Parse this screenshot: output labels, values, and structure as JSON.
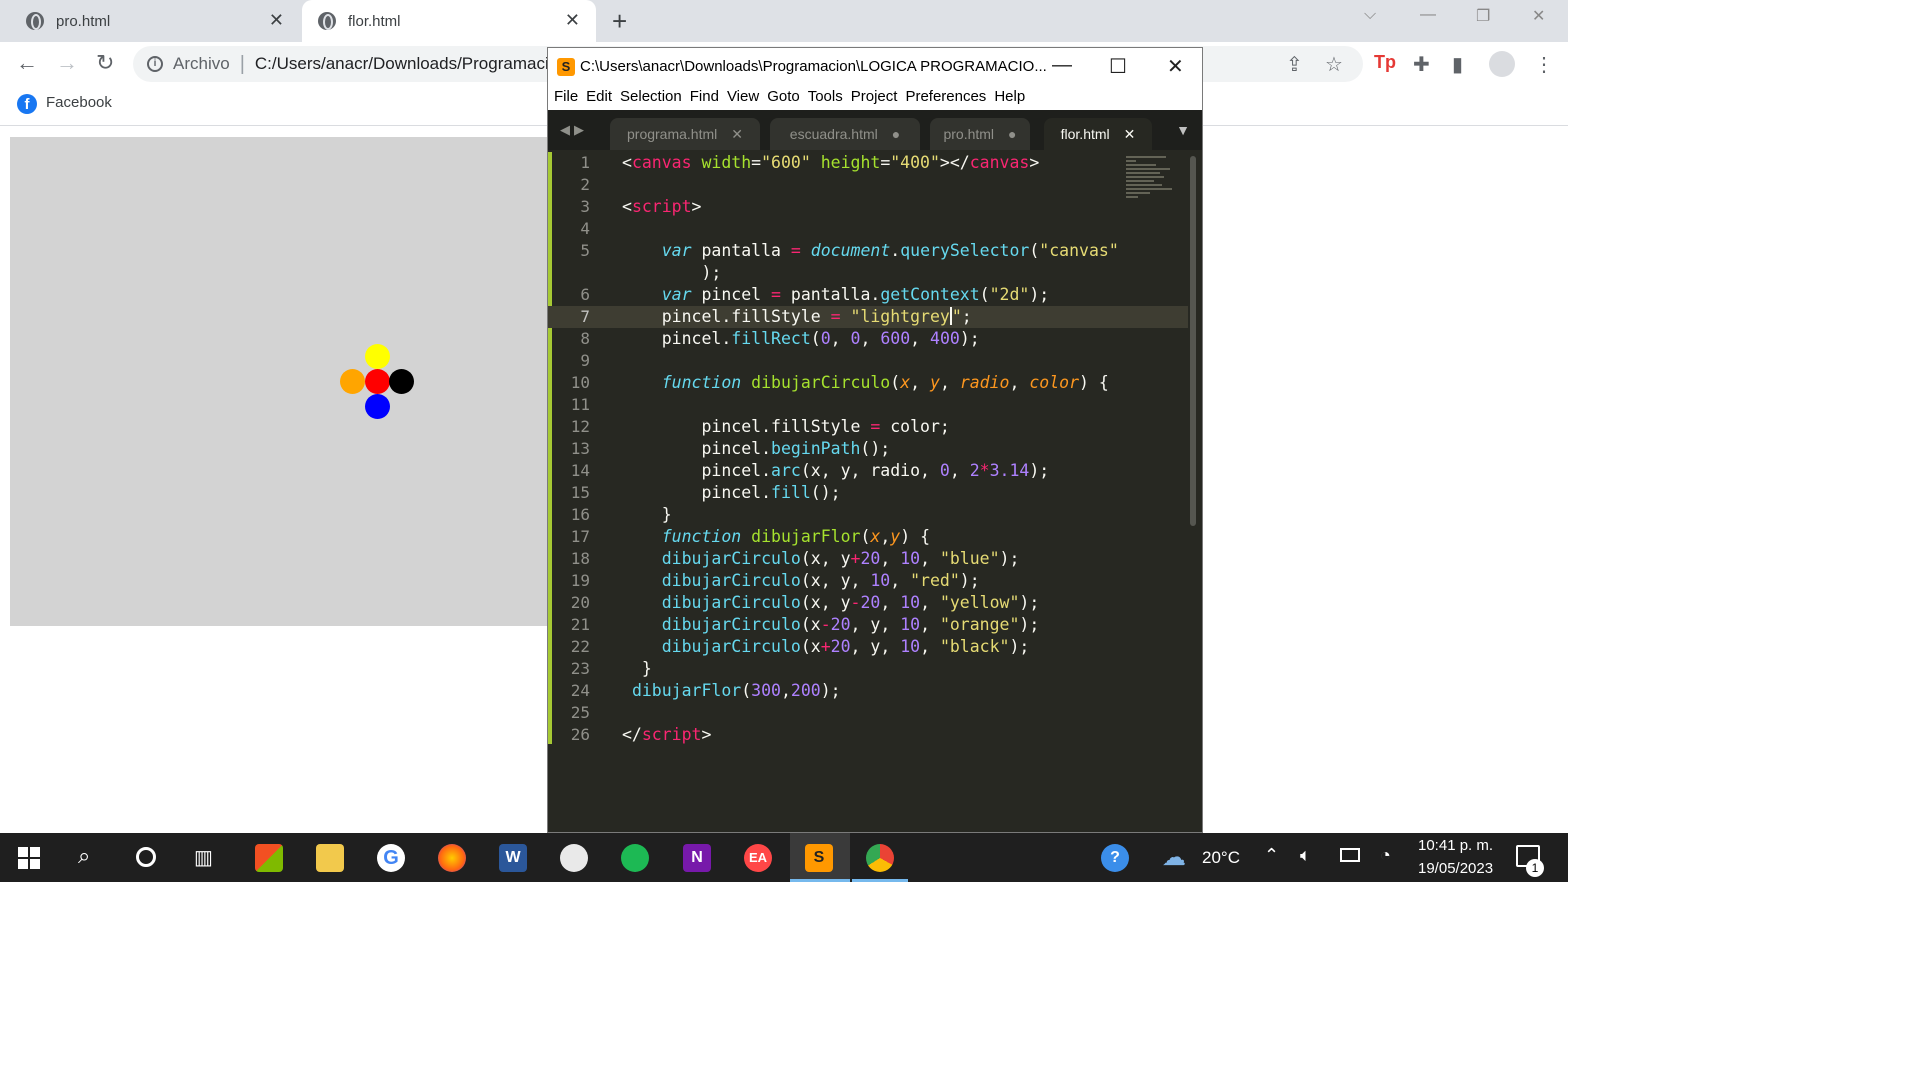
{
  "browser": {
    "tabs": [
      {
        "title": "pro.html"
      },
      {
        "title": "flor.html"
      }
    ],
    "new_tab": "+",
    "close_glyph": "✕",
    "omnibox": {
      "security_label": "Archivo",
      "url": "C:/Users/anacr/Downloads/Programaci"
    },
    "bookmarks": [
      {
        "label": "Facebook"
      }
    ]
  },
  "canvas_page": {
    "background": "#d3d3d3",
    "flower_colors": [
      "blue",
      "red",
      "yellow",
      "orange",
      "black"
    ]
  },
  "editor": {
    "title": "C:\\Users\\anacr\\Downloads\\Programacion\\LOGICA PROGRAMACIO...",
    "menu": [
      "File",
      "Edit",
      "Selection",
      "Find",
      "View",
      "Goto",
      "Tools",
      "Project",
      "Preferences",
      "Help"
    ],
    "tabs": [
      {
        "title": "programa.html",
        "marker": "✕"
      },
      {
        "title": "escuadra.html",
        "marker": "●"
      },
      {
        "title": "pro.html",
        "marker": "●"
      },
      {
        "title": "flor.html",
        "marker": "✕",
        "active": true
      }
    ],
    "current_line": 7,
    "line_numbers": [
      "1",
      "2",
      "3",
      "4",
      "5",
      "",
      "6",
      "7",
      "8",
      "9",
      "10",
      "11",
      "12",
      "13",
      "14",
      "15",
      "16",
      "17",
      "18",
      "19",
      "20",
      "21",
      "22",
      "23",
      "24",
      "25",
      "26"
    ]
  },
  "taskbar": {
    "weather": "20°C",
    "time": "10:41 p. m.",
    "date": "19/05/2023",
    "notification_count": "1"
  },
  "colors": {
    "sublime_bg": "#272822",
    "chrome_tabstrip": "#dee1e6",
    "taskbar": "#1f1f1f",
    "accent_green": "#a6c934"
  }
}
